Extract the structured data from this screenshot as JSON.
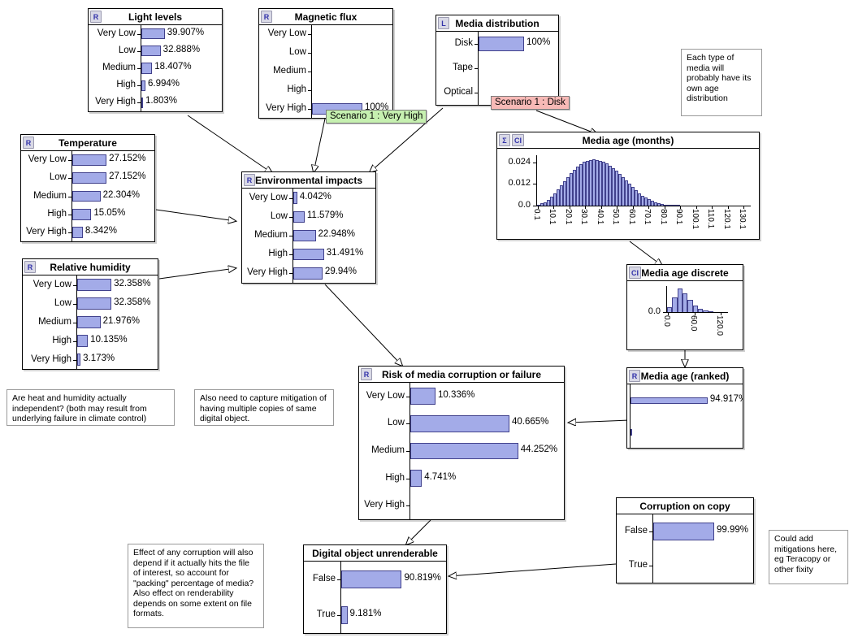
{
  "nodes": [
    {
      "id": "light-levels",
      "title": "Light levels",
      "badges": [
        "R"
      ],
      "states": [
        "Very Low",
        "Low",
        "Medium",
        "High",
        "Very High"
      ],
      "values": [
        39.907,
        32.888,
        18.407,
        6.994,
        1.803
      ],
      "labels": [
        "39.907%",
        "32.888%",
        "18.407%",
        "6.994%",
        "1.803%"
      ]
    },
    {
      "id": "magnetic-flux",
      "title": "Magnetic flux",
      "badges": [
        "R"
      ],
      "states": [
        "Very Low",
        "Low",
        "Medium",
        "High",
        "Very High"
      ],
      "values": [
        0,
        0,
        0,
        0,
        100
      ],
      "labels": [
        "",
        "",
        "",
        "",
        "100%"
      ]
    },
    {
      "id": "media-distribution",
      "title": "Media distribution",
      "badges": [
        "L"
      ],
      "states": [
        "Disk",
        "Tape",
        "Optical"
      ],
      "values": [
        100,
        0,
        0
      ],
      "labels": [
        "100%",
        "",
        ""
      ]
    },
    {
      "id": "temperature",
      "title": "Temperature",
      "badges": [
        "R"
      ],
      "states": [
        "Very Low",
        "Low",
        "Medium",
        "High",
        "Very High"
      ],
      "values": [
        27.152,
        27.152,
        22.304,
        15.05,
        8.342
      ],
      "labels": [
        "27.152%",
        "27.152%",
        "22.304%",
        "15.05%",
        "8.342%"
      ]
    },
    {
      "id": "relative-humidity",
      "title": "Relative humidity",
      "badges": [
        "R"
      ],
      "states": [
        "Very Low",
        "Low",
        "Medium",
        "High",
        "Very High"
      ],
      "values": [
        32.358,
        32.358,
        21.976,
        10.135,
        3.173
      ],
      "labels": [
        "32.358%",
        "32.358%",
        "21.976%",
        "10.135%",
        "3.173%"
      ]
    },
    {
      "id": "environmental-impacts",
      "title": "Environmental impacts",
      "badges": [
        "R"
      ],
      "states": [
        "Very Low",
        "Low",
        "Medium",
        "High",
        "Very High"
      ],
      "values": [
        4.042,
        11.579,
        22.948,
        31.491,
        29.94
      ],
      "labels": [
        "4.042%",
        "11.579%",
        "22.948%",
        "31.491%",
        "29.94%"
      ]
    },
    {
      "id": "risk-of-media-corruption",
      "title": "Risk of media corruption or failure",
      "badges": [
        "R"
      ],
      "states": [
        "Very Low",
        "Low",
        "Medium",
        "High",
        "Very High"
      ],
      "values": [
        10.336,
        40.665,
        44.252,
        4.741,
        0
      ],
      "labels": [
        "10.336%",
        "40.665%",
        "44.252%",
        "4.741%",
        ""
      ]
    },
    {
      "id": "digital-object-unrenderable",
      "title": "Digital object unrenderable",
      "badges": [],
      "states": [
        "False",
        "True"
      ],
      "values": [
        90.819,
        9.181
      ],
      "labels": [
        "90.819%",
        "9.181%"
      ]
    },
    {
      "id": "corruption-on-copy",
      "title": "Corruption on copy",
      "badges": [],
      "states": [
        "False",
        "True"
      ],
      "values": [
        99.99,
        0.01
      ],
      "labels": [
        "99.99%",
        ""
      ]
    },
    {
      "id": "media-age-ranked",
      "title": "Media age (ranked)",
      "badges": [
        "R"
      ],
      "states": [
        "",
        ""
      ],
      "values": [
        94.917,
        1.5
      ],
      "labels": [
        "94.917%",
        ""
      ]
    }
  ],
  "scenarios": [
    {
      "id": "scenario-magnetic-flux",
      "text": "Scenario 1 : Very High",
      "color": "green"
    },
    {
      "id": "scenario-media-distribution",
      "text": "Scenario 1 : Disk",
      "color": "red"
    }
  ],
  "notes": [
    {
      "id": "note-media-age",
      "text": "Each type of\nmedia will\nprobably have its\nown age\ndistribution"
    },
    {
      "id": "note-heat-humidity",
      "text": "Are heat and humidity actually\nindependent? (both may result from\nunderlying failure in climate control)"
    },
    {
      "id": "note-mitigation-copies",
      "text": "Also need to capture mitigation of\nhaving multiple copies of same\ndigital object."
    },
    {
      "id": "note-corruption-effect",
      "text": "Effect of any corruption will also\ndepend if it actually hits the file\nof interest, so account for\n\"packing\" percentage of media?\nAlso effect on renderability\ndepends on some extent on file\nformats."
    },
    {
      "id": "note-teracopy",
      "text": "Could add\nmitigations here,\neg Teracopy or\nother fixity"
    }
  ],
  "chart_data": [
    {
      "id": "media-age-months",
      "type": "bar",
      "title": "Media age (months)",
      "badges": [
        "Σ",
        "CI"
      ],
      "xlabel": "",
      "ylabel": "",
      "ylim": [
        0,
        0.028
      ],
      "yticks": [
        0.0,
        0.012,
        0.024
      ],
      "ytick_labels": [
        "0.0",
        "0.012",
        "0.024"
      ],
      "xticks": [
        0.1,
        10.1,
        20.1,
        30.1,
        40.1,
        50.1,
        60.1,
        70.1,
        80.1,
        90.1,
        100.1,
        110.1,
        120.1,
        130.1
      ],
      "xtick_labels": [
        "0.1",
        "10.1",
        "20.1",
        "30.1",
        "40.1",
        "50.1",
        "60.1",
        "70.1",
        "80.1",
        "90.1",
        "100.1",
        "110.1",
        "120.1",
        "130.1"
      ],
      "values": [
        0.0006,
        0.0012,
        0.002,
        0.0032,
        0.0048,
        0.0068,
        0.009,
        0.0112,
        0.0135,
        0.0158,
        0.018,
        0.02,
        0.0216,
        0.023,
        0.0242,
        0.025,
        0.0254,
        0.0256,
        0.0254,
        0.025,
        0.0244,
        0.0234,
        0.0222,
        0.0208,
        0.0192,
        0.0174,
        0.0156,
        0.0138,
        0.012,
        0.0102,
        0.0086,
        0.007,
        0.0056,
        0.0044,
        0.0034,
        0.0026,
        0.0019,
        0.0014,
        0.001,
        0.0006,
        0.0004,
        0.0002,
        0.0001,
        0.0001,
        0.0,
        0.0,
        0.0,
        0.0,
        0.0,
        0.0,
        0.0,
        0.0,
        0.0,
        0.0,
        0.0,
        0.0,
        0.0,
        0.0,
        0.0,
        0.0,
        0.0,
        0.0,
        0.0,
        0.0,
        0.0,
        0.0
      ]
    },
    {
      "id": "media-age-discrete",
      "type": "bar",
      "title": "Media age discrete",
      "badges": [
        "CI"
      ],
      "ylim": [
        0,
        1
      ],
      "yticks": [
        0.0
      ],
      "ytick_labels": [
        "0.0"
      ],
      "xticks": [
        0.0,
        60.0,
        120.0
      ],
      "xtick_labels": [
        "0.0",
        "60.0",
        "120.0"
      ],
      "values": [
        0.18,
        0.55,
        0.92,
        0.72,
        0.46,
        0.26,
        0.13,
        0.05,
        0.02,
        0.0,
        0.0,
        0.0
      ]
    }
  ]
}
